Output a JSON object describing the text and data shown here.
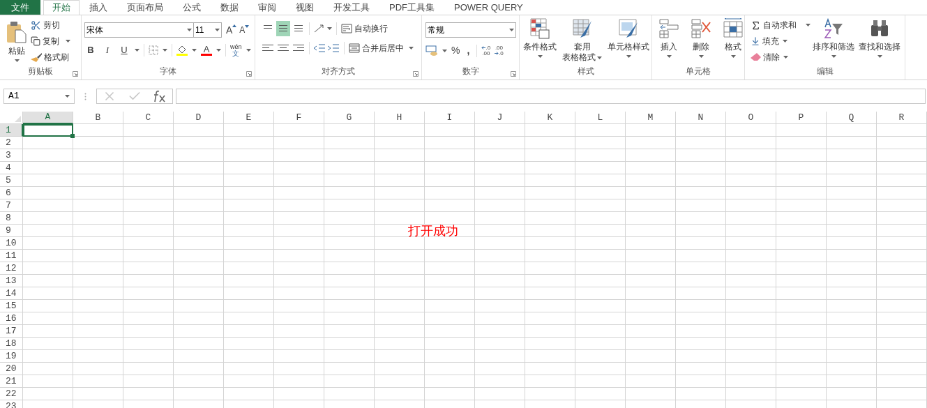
{
  "tabs": [
    {
      "label": "文件",
      "kind": "file",
      "selected": false
    },
    {
      "label": "开始",
      "kind": "tab",
      "selected": true
    },
    {
      "label": "插入",
      "kind": "tab",
      "selected": false
    },
    {
      "label": "页面布局",
      "kind": "tab",
      "selected": false
    },
    {
      "label": "公式",
      "kind": "tab",
      "selected": false
    },
    {
      "label": "数据",
      "kind": "tab",
      "selected": false
    },
    {
      "label": "审阅",
      "kind": "tab",
      "selected": false
    },
    {
      "label": "视图",
      "kind": "tab",
      "selected": false
    },
    {
      "label": "开发工具",
      "kind": "tab",
      "selected": false
    },
    {
      "label": "PDF工具集",
      "kind": "tab",
      "selected": false
    },
    {
      "label": "POWER QUERY",
      "kind": "tab",
      "selected": false
    }
  ],
  "ribbon": {
    "clipboard": {
      "label": "剪贴板",
      "launcher": true,
      "paste": "粘贴",
      "cut": "剪切",
      "copy": "复制",
      "format_painter": "格式刷"
    },
    "font": {
      "label": "字体",
      "launcher": true,
      "font_name": "宋体",
      "font_size": "11",
      "grow": "A",
      "shrink": "A",
      "bold": "B",
      "italic": "I",
      "underline": "U",
      "font_color": "A",
      "phonetic_top": "wén",
      "phonetic_bottom": "文"
    },
    "alignment": {
      "label": "对齐方式",
      "launcher": true,
      "vertical": [
        {
          "selected": false
        },
        {
          "selected": true
        },
        {
          "selected": false
        }
      ],
      "wrap": "自动换行",
      "merge": "合并后居中"
    },
    "number": {
      "label": "数字",
      "launcher": true,
      "format": "常规",
      "percent": "%",
      "comma": ",",
      "increase_decimal": [
        ".0",
        ".00"
      ],
      "decrease_decimal": [
        ".00",
        ".0"
      ]
    },
    "styles": {
      "label": "样式",
      "launcher": false,
      "conditional": "条件格式",
      "table_format": [
        "套用",
        "表格格式"
      ],
      "cell_styles": "单元格样式"
    },
    "cells": {
      "label": "单元格",
      "launcher": false,
      "insert": "插入",
      "delete": "删除",
      "format": "格式"
    },
    "editing": {
      "label": "编辑",
      "launcher": false,
      "autosum": "自动求和",
      "fill": "填充",
      "clear": "清除",
      "sort": "排序和筛选",
      "find": "查找和选择"
    }
  },
  "formula_bar": {
    "name_box": "A1"
  },
  "sheet": {
    "columns": [
      {
        "label": "A",
        "selected": true
      },
      {
        "label": "B",
        "selected": false
      },
      {
        "label": "C",
        "selected": false
      },
      {
        "label": "D",
        "selected": false
      },
      {
        "label": "E",
        "selected": false
      },
      {
        "label": "F",
        "selected": false
      },
      {
        "label": "G",
        "selected": false
      },
      {
        "label": "H",
        "selected": false
      },
      {
        "label": "I",
        "selected": false
      },
      {
        "label": "J",
        "selected": false
      },
      {
        "label": "K",
        "selected": false
      },
      {
        "label": "L",
        "selected": false
      },
      {
        "label": "M",
        "selected": false
      },
      {
        "label": "N",
        "selected": false
      },
      {
        "label": "O",
        "selected": false
      },
      {
        "label": "P",
        "selected": false
      },
      {
        "label": "Q",
        "selected": false
      },
      {
        "label": "R",
        "selected": false
      }
    ],
    "rows": [
      {
        "label": "1",
        "selected": true
      },
      {
        "label": "2",
        "selected": false
      },
      {
        "label": "3",
        "selected": false
      },
      {
        "label": "4",
        "selected": false
      },
      {
        "label": "5",
        "selected": false
      },
      {
        "label": "6",
        "selected": false
      },
      {
        "label": "7",
        "selected": false
      },
      {
        "label": "8",
        "selected": false
      },
      {
        "label": "9",
        "selected": false,
        "cell_h": "打开成功"
      },
      {
        "label": "10",
        "selected": false
      },
      {
        "label": "11",
        "selected": false
      },
      {
        "label": "12",
        "selected": false
      },
      {
        "label": "13",
        "selected": false
      },
      {
        "label": "14",
        "selected": false
      },
      {
        "label": "15",
        "selected": false
      },
      {
        "label": "16",
        "selected": false
      },
      {
        "label": "17",
        "selected": false
      },
      {
        "label": "18",
        "selected": false
      },
      {
        "label": "19",
        "selected": false
      },
      {
        "label": "20",
        "selected": false
      },
      {
        "label": "21",
        "selected": false
      },
      {
        "label": "22",
        "selected": false
      },
      {
        "label": "23",
        "selected": false
      }
    ]
  }
}
